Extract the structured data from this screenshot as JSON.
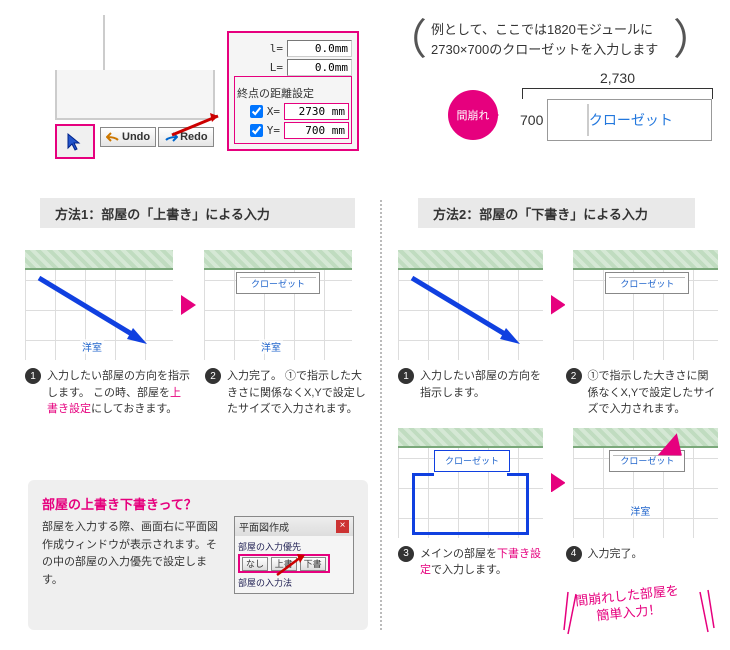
{
  "top": {
    "undo": "Undo",
    "redo": "Redo",
    "dialog": {
      "l0": "0.0mm",
      "lblL0": "l=",
      "lblL": "L=",
      "l": "0.0mm",
      "title": "終点の距離設定",
      "x": "2730 mm",
      "lblX": "X=",
      "y": "700 mm",
      "lblY": "Y="
    },
    "example": "例として、ここでは1820モジュールに2730×700のクローゼットを入力します",
    "magakure": "間崩れ",
    "closet": {
      "w": "2,730",
      "h": "700",
      "label": "クローゼット"
    }
  },
  "m1": {
    "header": "方法1：部屋の「上書き」による入力",
    "room": "洋室",
    "closet": "クローゼット",
    "s1": "入力したい部屋の方向を指示します。\nこの時、部屋を",
    "s1p": "上書き設定",
    "s1b": "にしておきます。",
    "s2a": "入力完了。\n①で指示した大きさに関係なくX,Yで設定したサイズで入力されます。"
  },
  "m2": {
    "header": "方法2：部屋の「下書き」による入力",
    "room": "洋室",
    "closet": "クローゼット",
    "s1": "入力したい部屋の方向を指示します。",
    "s2": "①で指示した大きさに関係なくX,Yで設定したサイズで入力されます。",
    "s3a": "メインの部屋を",
    "s3p": "下書き設定",
    "s3b": "で入力します。",
    "s4": "入力完了。"
  },
  "info": {
    "title": "部屋の上書き下書きって？",
    "text": "部屋を入力する際、画面右に平面図作成ウィンドウが表示されます。その中の部屋の入力優先で設定します。",
    "dlg": {
      "title": "平面図作成",
      "l1": "部屋の入力優先",
      "none": "なし",
      "over": "上書",
      "under": "下書",
      "l2": "部屋の入力法"
    }
  },
  "final": {
    "a": "間崩れした部屋を",
    "b": "簡単入力！"
  }
}
